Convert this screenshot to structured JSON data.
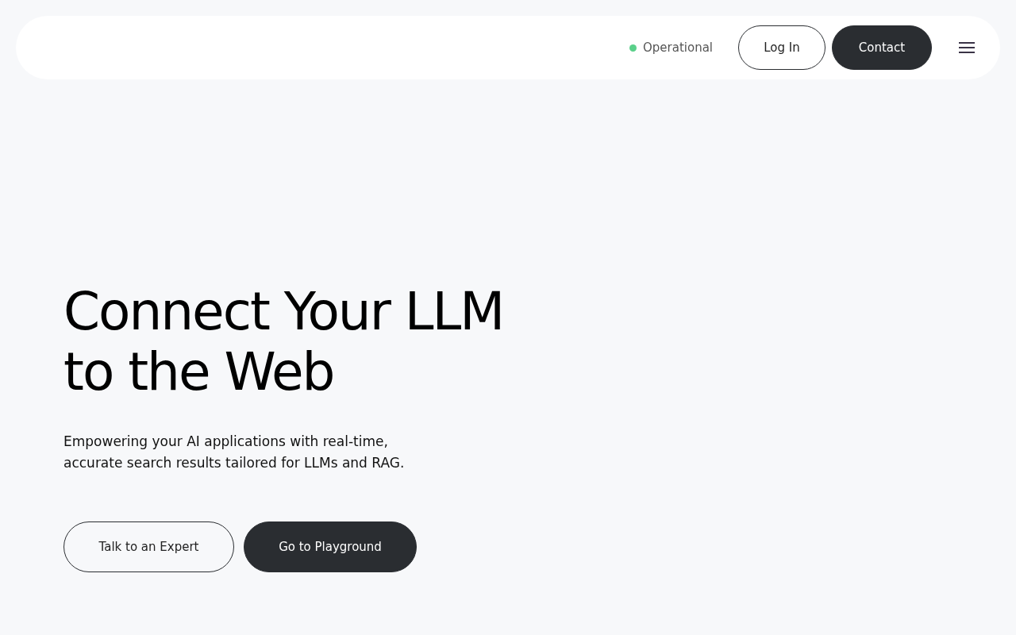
{
  "header": {
    "status": {
      "label": "Operational",
      "color": "#5ad08a"
    },
    "buttons": [
      {
        "label": "Log In",
        "kind": "outline"
      },
      {
        "label": "Contact",
        "kind": "filled"
      }
    ]
  },
  "hero": {
    "title_lines": [
      "Connect Your LLM",
      "to the Web"
    ],
    "subtitle_lines": [
      "Empowering your AI applications with real-time,",
      "accurate search results tailored for LLMs and RAG."
    ],
    "buttons": [
      {
        "label": "Talk to an Expert",
        "kind": "outline"
      },
      {
        "label": "Go to Playground",
        "kind": "filled"
      }
    ]
  }
}
